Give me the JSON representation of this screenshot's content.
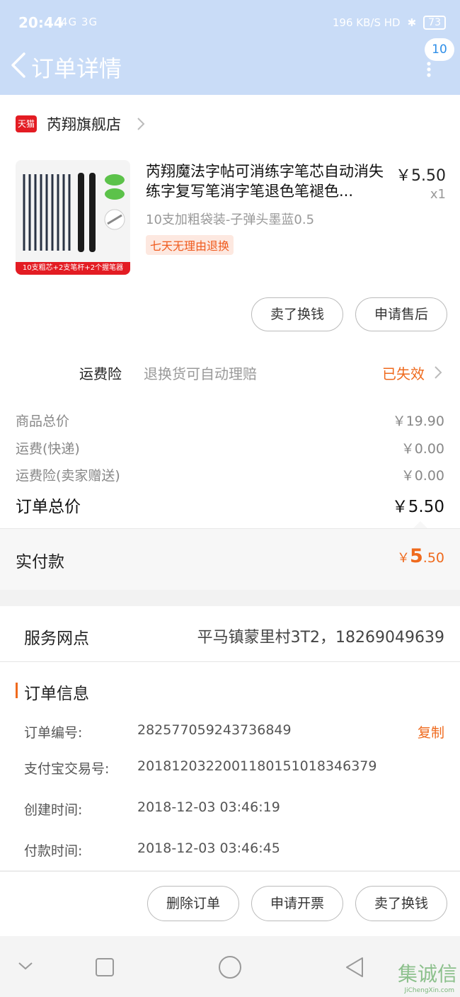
{
  "status_bar": {
    "time": "20:44",
    "network": "4G 3G",
    "speed": "196 KB/S HD",
    "battery": "73"
  },
  "header": {
    "title": "订单详情",
    "message_badge": "10"
  },
  "store": {
    "platform_badge": "天猫",
    "name": "芮翔旗舰店"
  },
  "product": {
    "image_caption": "10支粗芯+2支笔杆+2个握笔器",
    "title": "芮翔魔法字帖可消练字笔芯自动消失练字复写笔消字笔退色笔褪色...",
    "price": "￥5.50",
    "quantity": "x1",
    "variant": "10支加粗袋装-子弹头墨蓝0.5",
    "badge": "七天无理由退换"
  },
  "product_actions": {
    "sell_label": "卖了换钱",
    "after_sale_label": "申请售后"
  },
  "insurance": {
    "label": "运费险",
    "desc": "退换货可自动理赔",
    "status": "已失效"
  },
  "fees": [
    {
      "label": "商品总价",
      "value": "￥19.90"
    },
    {
      "label": "运费(快递)",
      "value": "￥0.00"
    },
    {
      "label": "运费险(卖家赠送)",
      "value": "￥0.00"
    }
  ],
  "total": {
    "label": "订单总价",
    "value": "￥5.50"
  },
  "paid": {
    "label": "实付款",
    "currency": "￥",
    "integer": "5",
    "decimal": ".50"
  },
  "service": {
    "label": "服务网点",
    "value": "平马镇蒙里村3T2，18269049639"
  },
  "order_info": {
    "title": "订单信息",
    "copy_label": "复制",
    "rows": [
      {
        "key": "订单编号:",
        "value": "282577059243736849"
      },
      {
        "key": "支付宝交易号:",
        "value": "2018120322001180151018346379"
      },
      {
        "key": "创建时间:",
        "value": "2018-12-03 03:46:19"
      },
      {
        "key": "付款时间:",
        "value": "2018-12-03 03:46:45"
      }
    ]
  },
  "bottom_actions": {
    "delete_label": "删除订单",
    "invoice_label": "申请开票",
    "sell_label": "卖了换钱"
  },
  "watermark": {
    "text": "集诚信",
    "url_text": "JiChengXin.com"
  },
  "colors": {
    "accent": "#ef6a1d",
    "header_bg": "#c9dcf7",
    "tmall_red": "#e31c23"
  }
}
